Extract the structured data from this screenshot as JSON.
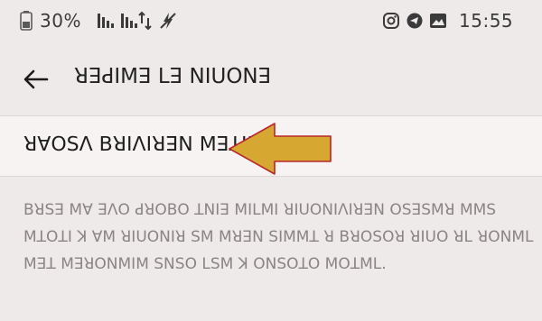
{
  "status_bar": {
    "time": "15:55",
    "battery_text": "30%",
    "icons": [
      "instagram-icon",
      "telegram-icon",
      "image-icon",
      "no-charge-icon",
      "data-arrows-icon",
      "signal-icon",
      "signal-icon",
      "alarm-icon",
      "battery-icon"
    ]
  },
  "app_bar": {
    "title": "ꓤꓱꓒꓲꓟꓱ ꓡꓱ ꓠꓲꓴꓳꓠꓱ",
    "back_icon": "arrow-left-icon"
  },
  "setting_item": {
    "label": "ꓤꓯꓳꓢꓥ ꓐꓤꓲꓥꓲꓤꓱꓠ ꓟꓱꓕꓲꓟ"
  },
  "description_lines": [
    "ꓐꓤꓢꓱ ꓟꓯ ꓱꓥꓳ ꓒꓤꓳꓐꓳ ꓕꓠꓲꓱ ꓟꓲꓡꓟꓲ ꓤꓲꓴꓳꓠꓲꓥꓲꓤꓱꓠ ꓳꓢꓱꓢꓟꓤ ꓟꓟꓢ",
    "ꓟꓕꓳꓕꓲ ꓘ ꓯꓟ ꓤꓲꓴꓳꓠꓲꓤ ꓢꓟ ꓟꓤꓱꓠ ꓢꓲꓟꓟꓕ ꓤ ꓐꓤꓳꓢꓳꓤ ꓤꓲꓴꓳ ꓤꓡ ꓤꓳꓠꓟꓡ",
    "ꓟꓱꓕ ꓟꓱꓤꓳꓠꓟꓲꓟ ꓢꓠꓢꓳ ꓡꓢꓟ ꓘ ꓳꓠꓢꓳꓕꓳ ꓟꓳꓕꓟꓡ."
  ],
  "colors": {
    "background": "#efeaea",
    "highlight_row": "#f7f3f3",
    "annotation_arrow_fill": "#d6a832",
    "annotation_arrow_stroke": "#b8262b"
  }
}
